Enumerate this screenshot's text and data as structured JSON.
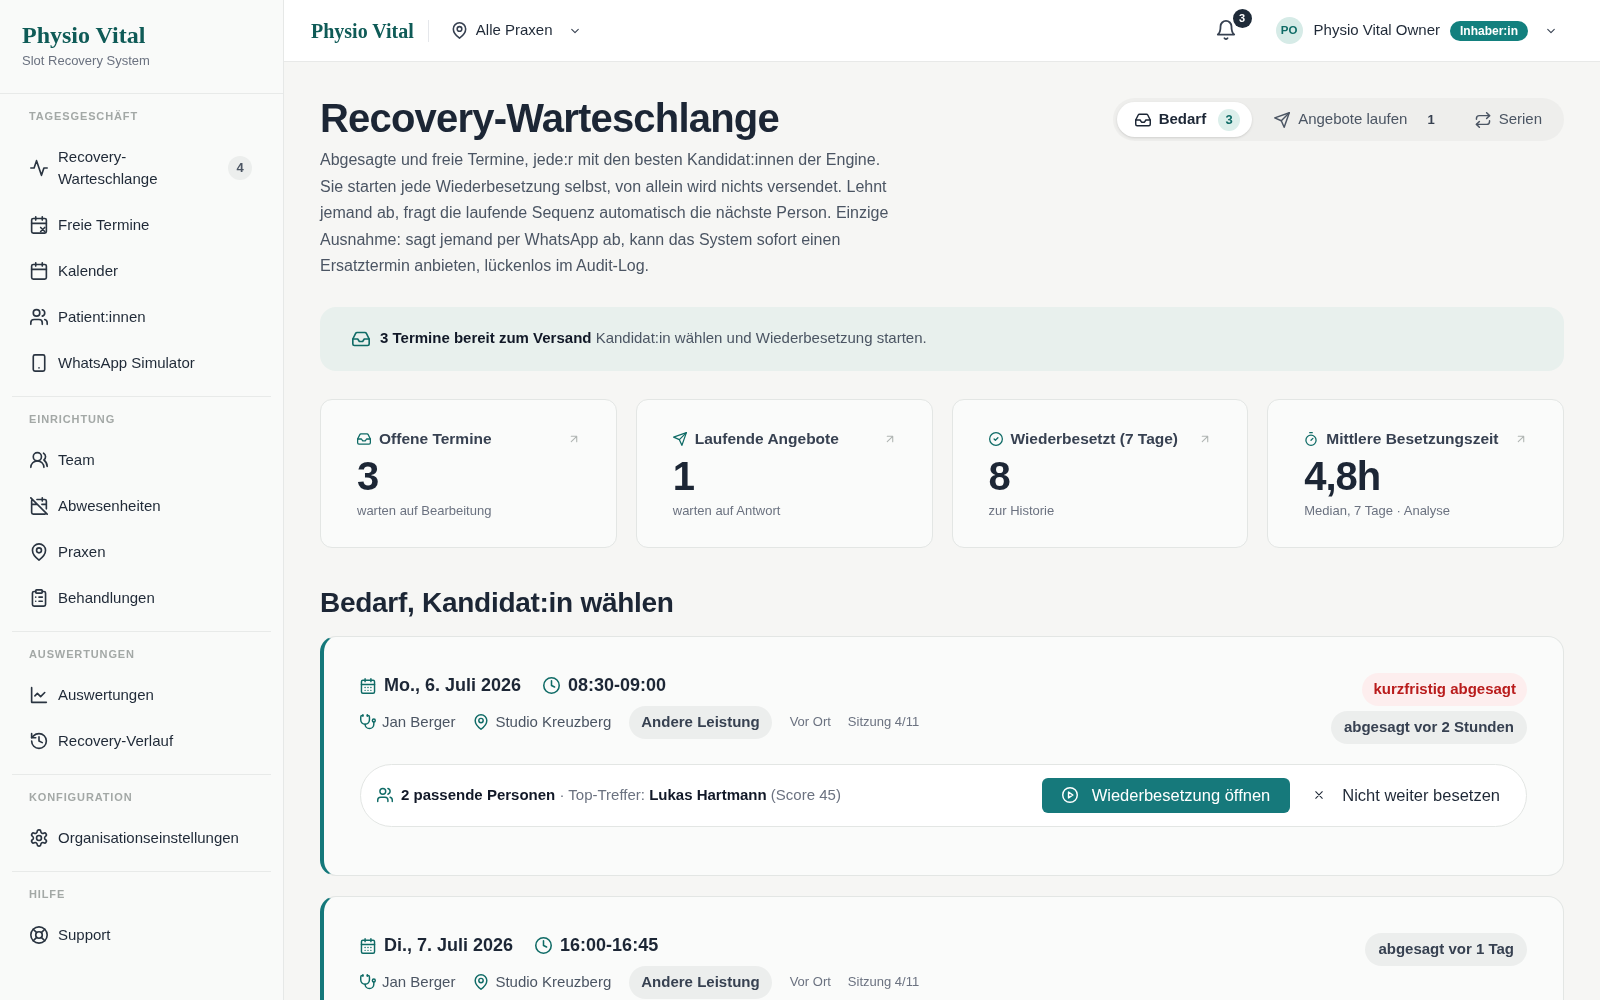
{
  "sidebar": {
    "brand": {
      "name": "Physio Vital",
      "tagline": "Slot Recovery System"
    },
    "sections": [
      {
        "heading": "TAGESGESCHÄFT",
        "items": [
          {
            "label": "Recovery-Warteschlange",
            "badge": "4"
          },
          {
            "label": "Freie Termine"
          },
          {
            "label": "Kalender"
          },
          {
            "label": "Patient:innen"
          },
          {
            "label": "WhatsApp Simulator"
          }
        ]
      },
      {
        "heading": "EINRICHTUNG",
        "items": [
          {
            "label": "Team"
          },
          {
            "label": "Abwesenheiten"
          },
          {
            "label": "Praxen"
          },
          {
            "label": "Behandlungen"
          }
        ]
      },
      {
        "heading": "AUSWERTUNGEN",
        "items": [
          {
            "label": "Auswertungen"
          },
          {
            "label": "Recovery-Verlauf"
          }
        ]
      },
      {
        "heading": "KONFIGURATION",
        "items": [
          {
            "label": "Organisationseinstellungen"
          }
        ]
      },
      {
        "heading": "HILFE",
        "items": [
          {
            "label": "Support"
          }
        ]
      }
    ]
  },
  "header": {
    "brand": "Physio Vital",
    "location": "Alle Praxen",
    "notification_count": "3",
    "user": {
      "initials": "PO",
      "name": "Physio Vital Owner",
      "role": "Inhaber:in"
    }
  },
  "page": {
    "title": "Recovery-Warteschlange",
    "description": "Abgesagte und freie Termine, jede:r mit den besten Kandidat:innen der Engine. Sie starten jede Wiederbesetzung selbst, von allein wird nichts versendet. Lehnt jemand ab, fragt die laufende Sequenz automatisch die nächste Person. Einzige Ausnahme: sagt jemand per WhatsApp ab, kann das System sofort einen Ersatztermin anbieten, lückenlos im Audit-Log.",
    "tabs": [
      {
        "label": "Bedarf",
        "count": "3",
        "selected": true
      },
      {
        "label": "Angebote laufen",
        "count": "1",
        "selected": false
      },
      {
        "label": "Serien",
        "selected": false
      }
    ],
    "banner": "**3 Termine bereit zum Versand** Kandidat:in wählen und Wiederbesetzung starten.",
    "kpis": [
      {
        "label": "Offene Termine",
        "value": "3",
        "note": "warten auf Bearbeitung"
      },
      {
        "label": "Laufende Angebote",
        "value": "1",
        "note": "warten auf Antwort"
      },
      {
        "label": "Wiederbesetzt (7 Tage)",
        "value": "8",
        "note": "zur Historie"
      },
      {
        "label": "Mittlere Besetzungszeit",
        "value": "4,8h",
        "note": "Median, 7 Tage · Analyse"
      }
    ],
    "section_title": "Bedarf, Kandidat:in wählen",
    "slots": [
      {
        "date": "Mo., 6. Juli 2026",
        "time": "08:30-09:00",
        "therapist": "Jan Berger",
        "location": "Studio Kreuzberg",
        "service": "Andere Leistung",
        "mode": "Vor Ort",
        "session": "Sitzung 4/11",
        "tags": [
          {
            "label": "kurzfristig abgesagt",
            "kind": "urgent"
          },
          {
            "label": "abgesagt vor 2 Stunden",
            "kind": "age"
          }
        ],
        "match": "**2 passende Personen** · Top-Treffer: **Lukas Hartmann** (Score 45)",
        "actions": [
          {
            "label": "Wiederbesetzung öffnen",
            "kind": "primary"
          },
          {
            "label": "Nicht weiter besetzen",
            "kind": "dismiss"
          }
        ]
      },
      {
        "date": "Di., 7. Juli 2026",
        "time": "16:00-16:45",
        "therapist": "Jan Berger",
        "location": "Studio Kreuzberg",
        "service": "Andere Leistung",
        "mode": "Vor Ort",
        "session": "Sitzung 4/11",
        "tags": [
          {
            "label": "abgesagt vor 1 Tag",
            "kind": "age"
          }
        ]
      }
    ]
  }
}
